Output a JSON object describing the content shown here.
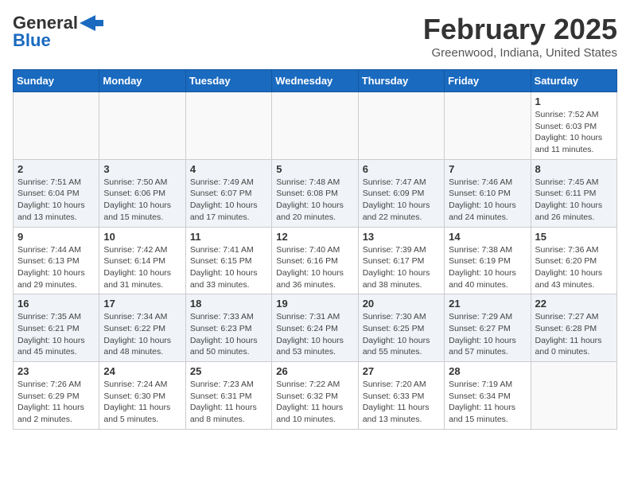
{
  "header": {
    "logo_general": "General",
    "logo_blue": "Blue",
    "month_title": "February 2025",
    "location": "Greenwood, Indiana, United States"
  },
  "weekdays": [
    "Sunday",
    "Monday",
    "Tuesday",
    "Wednesday",
    "Thursday",
    "Friday",
    "Saturday"
  ],
  "weeks": [
    [
      {
        "day": "",
        "info": ""
      },
      {
        "day": "",
        "info": ""
      },
      {
        "day": "",
        "info": ""
      },
      {
        "day": "",
        "info": ""
      },
      {
        "day": "",
        "info": ""
      },
      {
        "day": "",
        "info": ""
      },
      {
        "day": "1",
        "info": "Sunrise: 7:52 AM\nSunset: 6:03 PM\nDaylight: 10 hours\nand 11 minutes."
      }
    ],
    [
      {
        "day": "2",
        "info": "Sunrise: 7:51 AM\nSunset: 6:04 PM\nDaylight: 10 hours\nand 13 minutes."
      },
      {
        "day": "3",
        "info": "Sunrise: 7:50 AM\nSunset: 6:06 PM\nDaylight: 10 hours\nand 15 minutes."
      },
      {
        "day": "4",
        "info": "Sunrise: 7:49 AM\nSunset: 6:07 PM\nDaylight: 10 hours\nand 17 minutes."
      },
      {
        "day": "5",
        "info": "Sunrise: 7:48 AM\nSunset: 6:08 PM\nDaylight: 10 hours\nand 20 minutes."
      },
      {
        "day": "6",
        "info": "Sunrise: 7:47 AM\nSunset: 6:09 PM\nDaylight: 10 hours\nand 22 minutes."
      },
      {
        "day": "7",
        "info": "Sunrise: 7:46 AM\nSunset: 6:10 PM\nDaylight: 10 hours\nand 24 minutes."
      },
      {
        "day": "8",
        "info": "Sunrise: 7:45 AM\nSunset: 6:11 PM\nDaylight: 10 hours\nand 26 minutes."
      }
    ],
    [
      {
        "day": "9",
        "info": "Sunrise: 7:44 AM\nSunset: 6:13 PM\nDaylight: 10 hours\nand 29 minutes."
      },
      {
        "day": "10",
        "info": "Sunrise: 7:42 AM\nSunset: 6:14 PM\nDaylight: 10 hours\nand 31 minutes."
      },
      {
        "day": "11",
        "info": "Sunrise: 7:41 AM\nSunset: 6:15 PM\nDaylight: 10 hours\nand 33 minutes."
      },
      {
        "day": "12",
        "info": "Sunrise: 7:40 AM\nSunset: 6:16 PM\nDaylight: 10 hours\nand 36 minutes."
      },
      {
        "day": "13",
        "info": "Sunrise: 7:39 AM\nSunset: 6:17 PM\nDaylight: 10 hours\nand 38 minutes."
      },
      {
        "day": "14",
        "info": "Sunrise: 7:38 AM\nSunset: 6:19 PM\nDaylight: 10 hours\nand 40 minutes."
      },
      {
        "day": "15",
        "info": "Sunrise: 7:36 AM\nSunset: 6:20 PM\nDaylight: 10 hours\nand 43 minutes."
      }
    ],
    [
      {
        "day": "16",
        "info": "Sunrise: 7:35 AM\nSunset: 6:21 PM\nDaylight: 10 hours\nand 45 minutes."
      },
      {
        "day": "17",
        "info": "Sunrise: 7:34 AM\nSunset: 6:22 PM\nDaylight: 10 hours\nand 48 minutes."
      },
      {
        "day": "18",
        "info": "Sunrise: 7:33 AM\nSunset: 6:23 PM\nDaylight: 10 hours\nand 50 minutes."
      },
      {
        "day": "19",
        "info": "Sunrise: 7:31 AM\nSunset: 6:24 PM\nDaylight: 10 hours\nand 53 minutes."
      },
      {
        "day": "20",
        "info": "Sunrise: 7:30 AM\nSunset: 6:25 PM\nDaylight: 10 hours\nand 55 minutes."
      },
      {
        "day": "21",
        "info": "Sunrise: 7:29 AM\nSunset: 6:27 PM\nDaylight: 10 hours\nand 57 minutes."
      },
      {
        "day": "22",
        "info": "Sunrise: 7:27 AM\nSunset: 6:28 PM\nDaylight: 11 hours\nand 0 minutes."
      }
    ],
    [
      {
        "day": "23",
        "info": "Sunrise: 7:26 AM\nSunset: 6:29 PM\nDaylight: 11 hours\nand 2 minutes."
      },
      {
        "day": "24",
        "info": "Sunrise: 7:24 AM\nSunset: 6:30 PM\nDaylight: 11 hours\nand 5 minutes."
      },
      {
        "day": "25",
        "info": "Sunrise: 7:23 AM\nSunset: 6:31 PM\nDaylight: 11 hours\nand 8 minutes."
      },
      {
        "day": "26",
        "info": "Sunrise: 7:22 AM\nSunset: 6:32 PM\nDaylight: 11 hours\nand 10 minutes."
      },
      {
        "day": "27",
        "info": "Sunrise: 7:20 AM\nSunset: 6:33 PM\nDaylight: 11 hours\nand 13 minutes."
      },
      {
        "day": "28",
        "info": "Sunrise: 7:19 AM\nSunset: 6:34 PM\nDaylight: 11 hours\nand 15 minutes."
      },
      {
        "day": "",
        "info": ""
      }
    ]
  ]
}
